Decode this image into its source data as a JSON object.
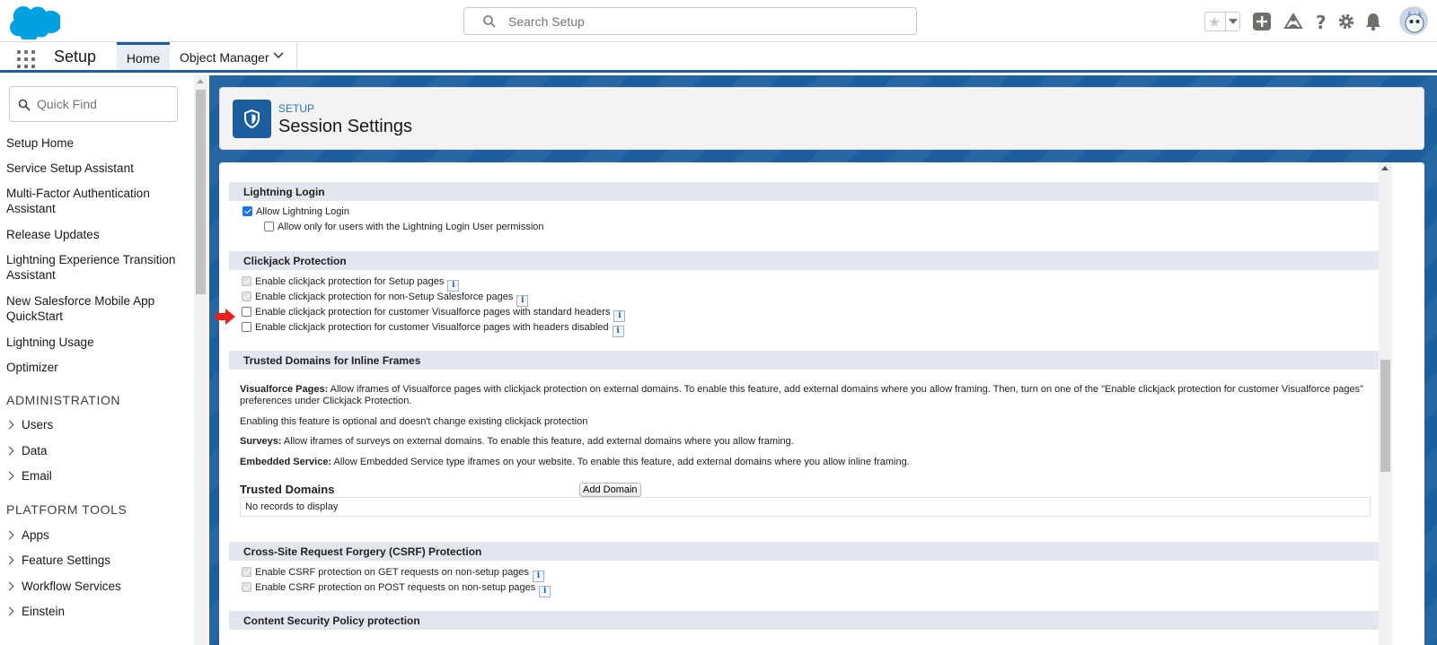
{
  "header": {
    "search_placeholder": "Search Setup",
    "icons": [
      "favorites-star-icon",
      "add-icon",
      "trailhead-icon",
      "help-icon",
      "settings-gear-icon",
      "notifications-bell-icon",
      "avatar"
    ]
  },
  "context_bar": {
    "app_name": "Setup",
    "tabs": [
      {
        "label": "Home",
        "active": true
      },
      {
        "label": "Object Manager",
        "active": false
      }
    ]
  },
  "sidebar": {
    "quick_find_placeholder": "Quick Find",
    "items": [
      {
        "label": "Setup Home"
      },
      {
        "label": "Service Setup Assistant"
      },
      {
        "label": "Multi-Factor Authentication Assistant"
      },
      {
        "label": "Release Updates"
      },
      {
        "label": "Lightning Experience Transition Assistant"
      },
      {
        "label": "New Salesforce Mobile App QuickStart"
      },
      {
        "label": "Lightning Usage"
      },
      {
        "label": "Optimizer"
      }
    ],
    "section_admin": "ADMINISTRATION",
    "admin_items": [
      "Users",
      "Data",
      "Email"
    ],
    "section_platform": "PLATFORM TOOLS",
    "platform_items": [
      "Apps",
      "Feature Settings",
      "Workflow Services",
      "Einstein"
    ]
  },
  "page_header": {
    "eyebrow": "SETUP",
    "title": "Session Settings"
  },
  "sections": {
    "lightning_login": {
      "title": "Lightning Login",
      "allow_label": "Allow Lightning Login",
      "allow_checked": true,
      "only_perm_label": "Allow only for users with the Lightning Login User permission",
      "only_perm_checked": false
    },
    "clickjack": {
      "title": "Clickjack Protection",
      "options": [
        {
          "label": "Enable clickjack protection for Setup pages",
          "checked": true,
          "disabled": true
        },
        {
          "label": "Enable clickjack protection for non-Setup Salesforce pages",
          "checked": true,
          "disabled": true
        },
        {
          "label": "Enable clickjack protection for customer Visualforce pages with standard headers",
          "checked": false,
          "disabled": false
        },
        {
          "label": "Enable clickjack protection for customer Visualforce pages with headers disabled",
          "checked": false,
          "disabled": false
        }
      ]
    },
    "trusted_domains": {
      "title": "Trusted Domains for Inline Frames",
      "vf_bold": "Visualforce Pages:",
      "vf_text": " Allow iframes of Visualforce pages with clickjack protection on external domains. To enable this feature, add external domains where you allow framing. Then, turn on one of the \"Enable clickjack protection for customer Visualforce pages\" preferences under Clickjack Protection.",
      "optional_text": "Enabling this feature is optional and doesn't change existing clickjack protection",
      "surveys_bold": "Surveys:",
      "surveys_text": " Allow iframes of surveys on external domains. To enable this feature, add external domains where you allow framing.",
      "embedded_bold": "Embedded Service:",
      "embedded_text": " Allow Embedded Service type iframes on your website. To enable this feature, add external domains where you allow inline framing.",
      "list_label": "Trusted Domains",
      "add_button": "Add Domain",
      "empty_text": "No records to display"
    },
    "csrf": {
      "title": "Cross-Site Request Forgery (CSRF) Protection",
      "options": [
        {
          "label": "Enable CSRF protection on GET requests on non-setup pages",
          "checked": true,
          "disabled": true
        },
        {
          "label": "Enable CSRF protection on POST requests on non-setup pages",
          "checked": true,
          "disabled": true
        }
      ]
    },
    "csp": {
      "title": "Content Security Policy protection"
    }
  },
  "colors": {
    "brand_blue": "#1b5f9e",
    "section_bg": "#e3e6ec",
    "annotation_arrow": "#e8201e"
  }
}
